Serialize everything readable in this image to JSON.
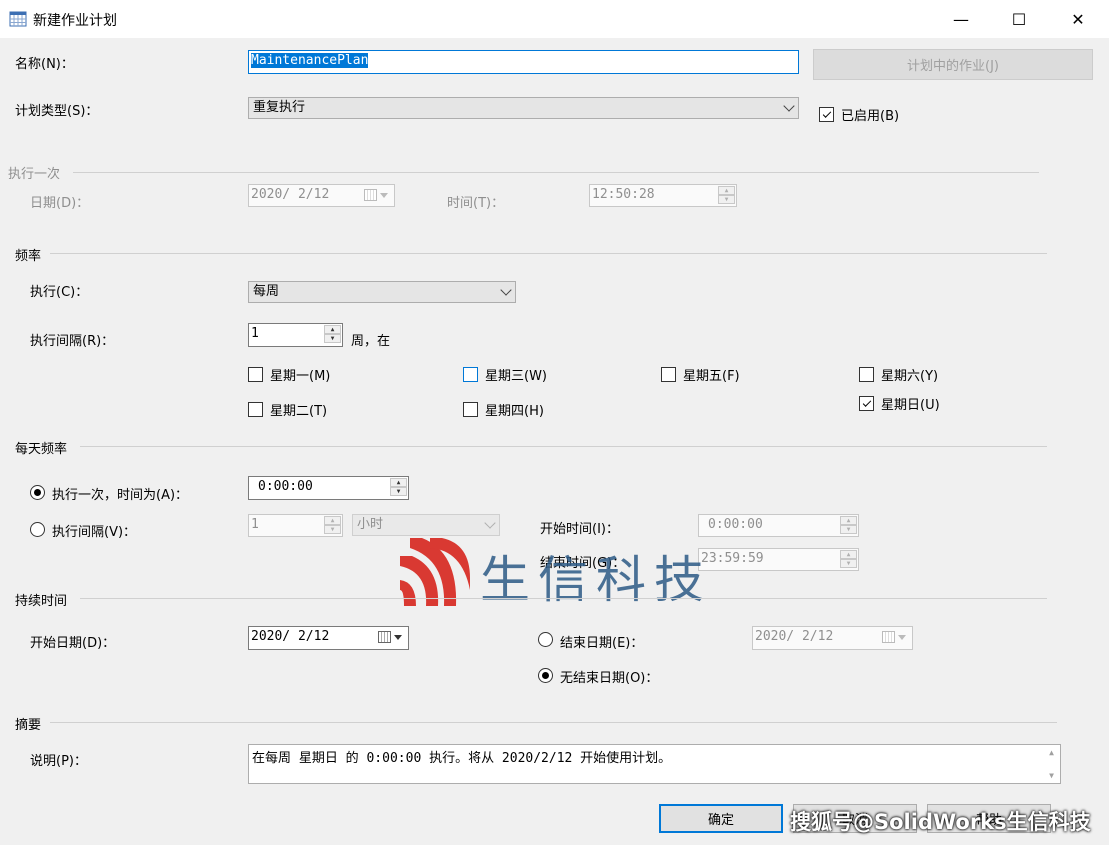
{
  "window": {
    "title": "新建作业计划",
    "minimize": "—",
    "maximize": "☐",
    "close": "✕"
  },
  "name": {
    "label": "名称(N)：",
    "value": "MaintenancePlan",
    "jobs_button": "计划中的作业(J)"
  },
  "schedule_type": {
    "label": "计划类型(S)：",
    "value": "重复执行",
    "enabled_label": "已启用(B)",
    "enabled": true
  },
  "once": {
    "header": "执行一次",
    "date_label": "日期(D)：",
    "date_value": "2020/ 2/12",
    "time_label": "时间(T)：",
    "time_value": "12:50:28"
  },
  "frequency": {
    "header": "频率",
    "occurs_label": "执行(C)：",
    "occurs_value": "每周",
    "recur_label": "执行间隔(R)：",
    "recur_value": "1",
    "recur_unit": "周，在",
    "days": [
      {
        "label": "星期一(M)",
        "checked": false
      },
      {
        "label": "星期二(T)",
        "checked": false
      },
      {
        "label": "星期三(W)",
        "checked": false
      },
      {
        "label": "星期四(H)",
        "checked": false
      },
      {
        "label": "星期五(F)",
        "checked": false
      },
      {
        "label": "星期六(Y)",
        "checked": false
      },
      {
        "label": "星期日(U)",
        "checked": true
      }
    ]
  },
  "daily": {
    "header": "每天频率",
    "once_label": "执行一次，时间为(A)：",
    "once_value": "0:00:00",
    "interval_label": "执行间隔(V)：",
    "interval_value": "1",
    "interval_unit": "小时",
    "start_label": "开始时间(I)：",
    "start_value": "0:00:00",
    "end_label": "结束时间(G)：",
    "end_value": "23:59:59"
  },
  "duration": {
    "header": "持续时间",
    "start_label": "开始日期(D)：",
    "start_value": "2020/ 2/12",
    "end_label": "结束日期(E)：",
    "end_value": "2020/ 2/12",
    "noend_label": "无结束日期(O)："
  },
  "summary": {
    "header": "摘要",
    "desc_label": "说明(P)：",
    "desc_value": "在每周 星期日 的 0:00:00 执行。将从 2020/2/12 开始使用计划。"
  },
  "buttons": {
    "ok": "确定",
    "cancel": "取消",
    "help": "帮助"
  },
  "watermark": {
    "text": "生信科技",
    "corner": "搜狐号@SolidWorks生信科技"
  },
  "colors": {
    "accent": "#0078d7",
    "watermark_red": "#d7261e",
    "watermark_blue": "#2d5a86"
  }
}
